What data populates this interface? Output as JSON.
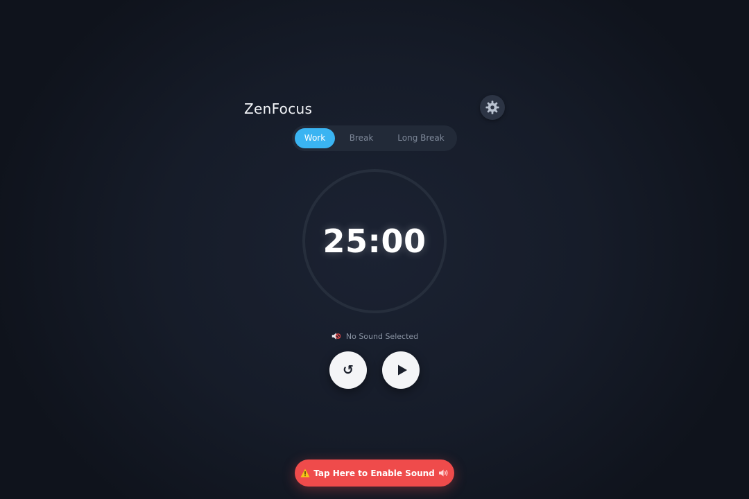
{
  "app": {
    "title": "ZenFocus"
  },
  "settings": {
    "icon": "gear-icon"
  },
  "modes": {
    "tabs": [
      {
        "label": "Work",
        "active": true
      },
      {
        "label": "Break",
        "active": false
      },
      {
        "label": "Long Break",
        "active": false
      }
    ]
  },
  "timer": {
    "display": "25:00"
  },
  "sound": {
    "status": "No Sound Selected",
    "icon": "muted-speaker-icon"
  },
  "controls": {
    "reset_icon": "reset-icon",
    "reset_glyph": "↺",
    "play_icon": "play-icon"
  },
  "banner": {
    "label": "Tap Here to Enable Sound",
    "leading_icon": "warning-icon",
    "trailing_icon": "speaker-icon"
  },
  "colors": {
    "accent": "#3ab4f2",
    "alert": "#ef4b4b",
    "background": "#161c29"
  }
}
